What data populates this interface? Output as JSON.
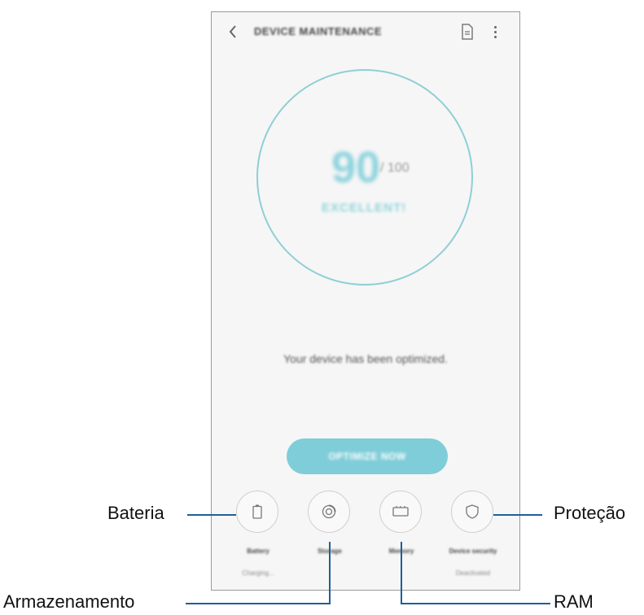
{
  "appbar": {
    "title": "DEVICE MAINTENANCE",
    "back_icon": "back-arrow-icon",
    "doc_icon": "document-icon",
    "more_icon": "more-vert-icon"
  },
  "score": {
    "value": "90",
    "max": "/ 100",
    "status": "EXCELLENT!",
    "progress": 1.0,
    "ring_color": "#8fcfd6"
  },
  "message": "Your device has been optimized.",
  "optimize_button": {
    "label": "OPTIMIZE NOW",
    "color": "#7fcdd8"
  },
  "tiles": [
    {
      "label": "Battery",
      "status": "Charging...",
      "icon": "battery-icon"
    },
    {
      "label": "Storage",
      "status": "",
      "icon": "storage-icon"
    },
    {
      "label": "Memory",
      "status": "",
      "icon": "memory-icon"
    },
    {
      "label": "Device security",
      "status": "Deactivated",
      "icon": "shield-icon"
    }
  ],
  "callouts": {
    "bateria": "Bateria",
    "armazenamento": "Armazenamento",
    "ram": "RAM",
    "protecao": "Proteção"
  },
  "colors": {
    "callout_line": "#1f5f9a",
    "accent": "#7fcdd8"
  }
}
